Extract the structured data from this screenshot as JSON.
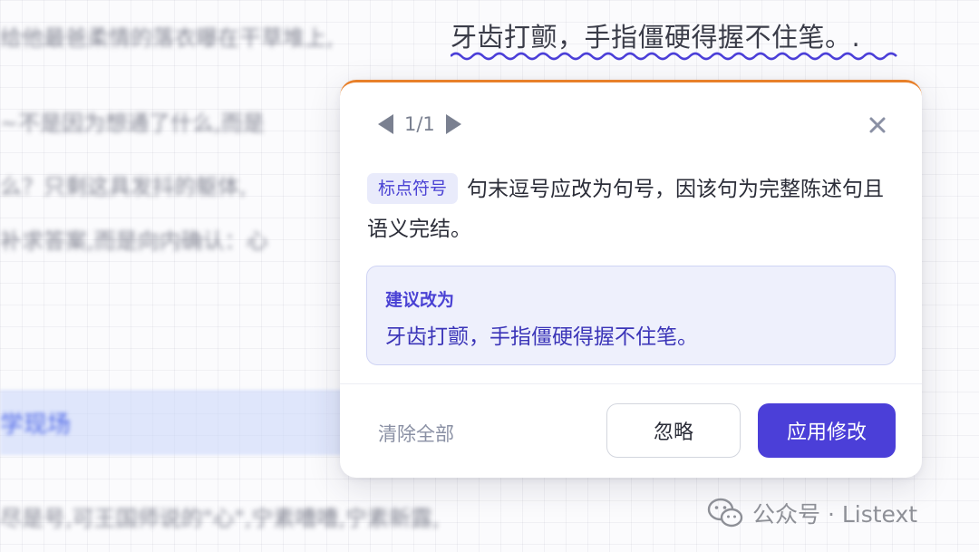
{
  "background": {
    "lines": [
      "给他最爸柔情的落衣曝在干草堆上,",
      "~不是因为想通了什么,而是",
      "么？只剩这具发抖的躯体,",
      "补求答案,而是向内确认：心",
      "尽是号,可王国师说的\"心\",宁素嘈嘈,宁素新露,"
    ],
    "link_text": "学现场"
  },
  "flagged_sentence": "牙齿打颤，手指僵硬得握不住笔。.",
  "popover": {
    "pager": {
      "count": "1/1"
    },
    "tag": "标点符号",
    "description": "句末逗号应改为句号，因该句为完整陈述句且语义完结。",
    "suggestion": {
      "title": "建议改为",
      "text": "牙齿打颤，手指僵硬得握不住笔。"
    },
    "footer": {
      "clear_all": "清除全部",
      "ignore": "忽略",
      "apply": "应用修改"
    },
    "accent_color": "#e8802a",
    "primary_color": "#4b3fd8"
  },
  "watermark": {
    "account": "公众号 · Listext"
  }
}
